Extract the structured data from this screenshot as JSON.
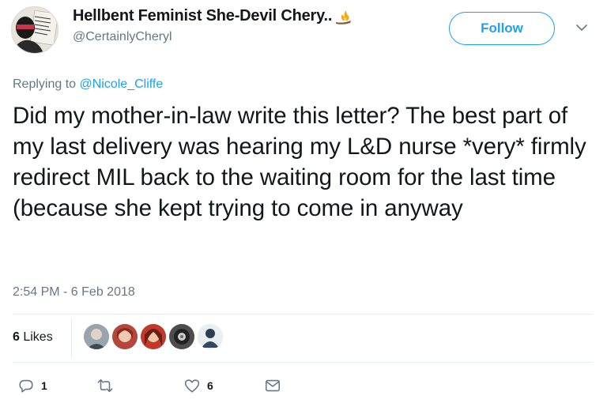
{
  "user": {
    "display_name": "Hellbent Feminist She-Devil Chery..",
    "handle": "@CertainlyCheryl",
    "avatar_sign_text": "A WOMAN IS A DANGEROUS CREATURE"
  },
  "follow_button": {
    "label": "Follow"
  },
  "reply": {
    "prefix": "Replying to ",
    "mention": "@Nicole_Cliffe"
  },
  "tweet": {
    "text": "Did my mother-in-law write this letter? The best part of my last delivery was hearing my L&D nurse *very* firmly redirect MIL back to the waiting room for the last time (because she kept trying to come in anyway",
    "timestamp": "2:54 PM - 6 Feb 2018"
  },
  "likes": {
    "count": "6",
    "label": " Likes"
  },
  "actions": {
    "reply_count": "1",
    "retweet_count": "",
    "like_count": "6"
  },
  "colors": {
    "accent": "#1da1f2",
    "secondary_text": "#657786",
    "divider": "#e6ecf0"
  },
  "icons": [
    "chevron-down-icon",
    "reply-icon",
    "retweet-icon",
    "heart-icon",
    "envelope-icon",
    "fire-emoji-icon"
  ]
}
